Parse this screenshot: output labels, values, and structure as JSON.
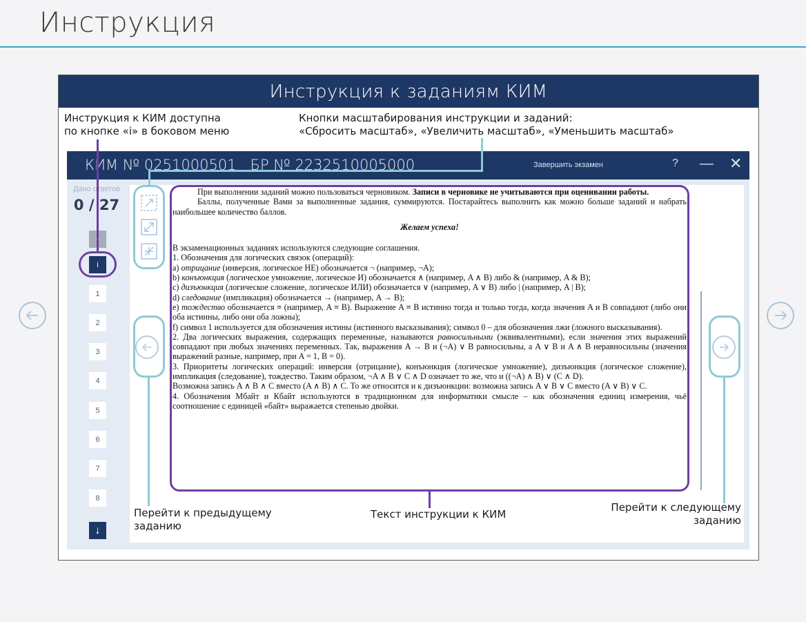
{
  "page": {
    "title": "Инструкция"
  },
  "frame": {
    "header": "Инструкция к заданиям КИМ"
  },
  "annotations": {
    "info_line1": "Инструкция к КИМ доступна",
    "info_line2": "по кнопке «i» в боковом меню",
    "zoom_line1": "Кнопки масштабирования инструкции и заданий:",
    "zoom_line2": "«Сбросить масштаб», «Увеличить масштаб», «Уменьшить масштаб»",
    "prev_line1": "Перейти к предыдущему",
    "prev_line2": "заданию",
    "text_label": "Текст инструкции к КИМ",
    "next_line1": "Перейти к следующему",
    "next_line2": "заданию"
  },
  "app": {
    "title": "КИМ № 0251000501   БР № 2232510005000",
    "finish": "Завершить экзамен",
    "help": "?",
    "minimize": "—",
    "close": "✕"
  },
  "sidebar": {
    "given_label": "Дано ответов",
    "given_count": "0 / 27",
    "up": "^",
    "info": "i",
    "items": [
      "1",
      "2",
      "3",
      "4",
      "5",
      "6",
      "7",
      "8"
    ],
    "down": "↓"
  },
  "icons": {
    "reset_zoom": "reset-zoom-icon",
    "zoom_in": "zoom-in-icon",
    "zoom_out": "zoom-out-icon",
    "prev": "arrow-left-icon",
    "next": "arrow-right-icon"
  },
  "colors": {
    "navy": "#1e3866",
    "accent": "#3aa5c3",
    "highlight_purple": "#6e3ea3",
    "highlight_teal": "#8fcad6"
  },
  "doc": {
    "p1_a": "При выполнении заданий можно пользоваться черновиком. ",
    "p1_b": "Записи в черновике не учитываются при оценивании работы.",
    "p2": "Баллы, полученные Вами за выполненные задания, суммируются. Постарайтесь выполнить как можно больше заданий и набрать наибольшее количество баллов.",
    "wish": "Желаем успеха!",
    "p3": "В экзаменационных заданиях используются следующие соглашения.",
    "p4": "1. Обозначения для логических связок (операций):",
    "a_t": "отрицание",
    "a": " (инверсия, логическое НЕ) обозначается ¬ (например, ¬A);",
    "b_t": "конъюнкция",
    "b": " (логическое умножение, логическое И) обозначается ∧ (например, A ∧ B) либо & (например, A & B);",
    "c_t": "дизъюнкция",
    "c": " (логическое сложение, логическое ИЛИ) обозначается ∨ (например, A ∨ B) либо | (например, A | B);",
    "d_t": "следование",
    "d": " (импликация) обозначается → (например, A → B);",
    "e_t": "тождество",
    "e": " обозначается ≡ (например, A ≡ B). Выражение A ≡ B истинно тогда и только тогда, когда значения A и B совпадают (либо они оба истинны, либо они оба ложны);",
    "f": "f) символ 1 используется для обозначения истины (истинного высказывания); символ 0 – для обозначения лжи (ложного высказывания).",
    "p5_a": "2. Два логических выражения, содержащих переменные, называются ",
    "p5_t": "равносильными",
    "p5_b": " (эквивалентными), если значения этих выражений совпадают при любых значениях переменных. Так, выражения A → B и (¬A) ∨ B равносильны, а A ∨ B и A ∧ B неравносильны (значения выражений разные, например, при A = 1, B = 0).",
    "p6": "3. Приоритеты логических операций: инверсия (отрицание), конъюнкция (логическое умножение), дизъюнкция (логическое сложение), импликация (следование), тождество. Таким образом, ¬A ∧ B ∨ C ∧ D означает то же, что и ((¬A) ∧ B) ∨ (C ∧ D).",
    "p7": "Возможна запись A ∧ B ∧ C вместо (A ∧ B) ∧ C. То же относится и к дизъюнкции: возможна запись A ∨ B ∨ C вместо (A ∨ B) ∨ C.",
    "p8": "4. Обозначения Мбайт и Кбайт используются в традиционном для информатики смысле – как обозначения единиц измерения, чьё соотношение с единицей «байт» выражается степенью двойки."
  }
}
